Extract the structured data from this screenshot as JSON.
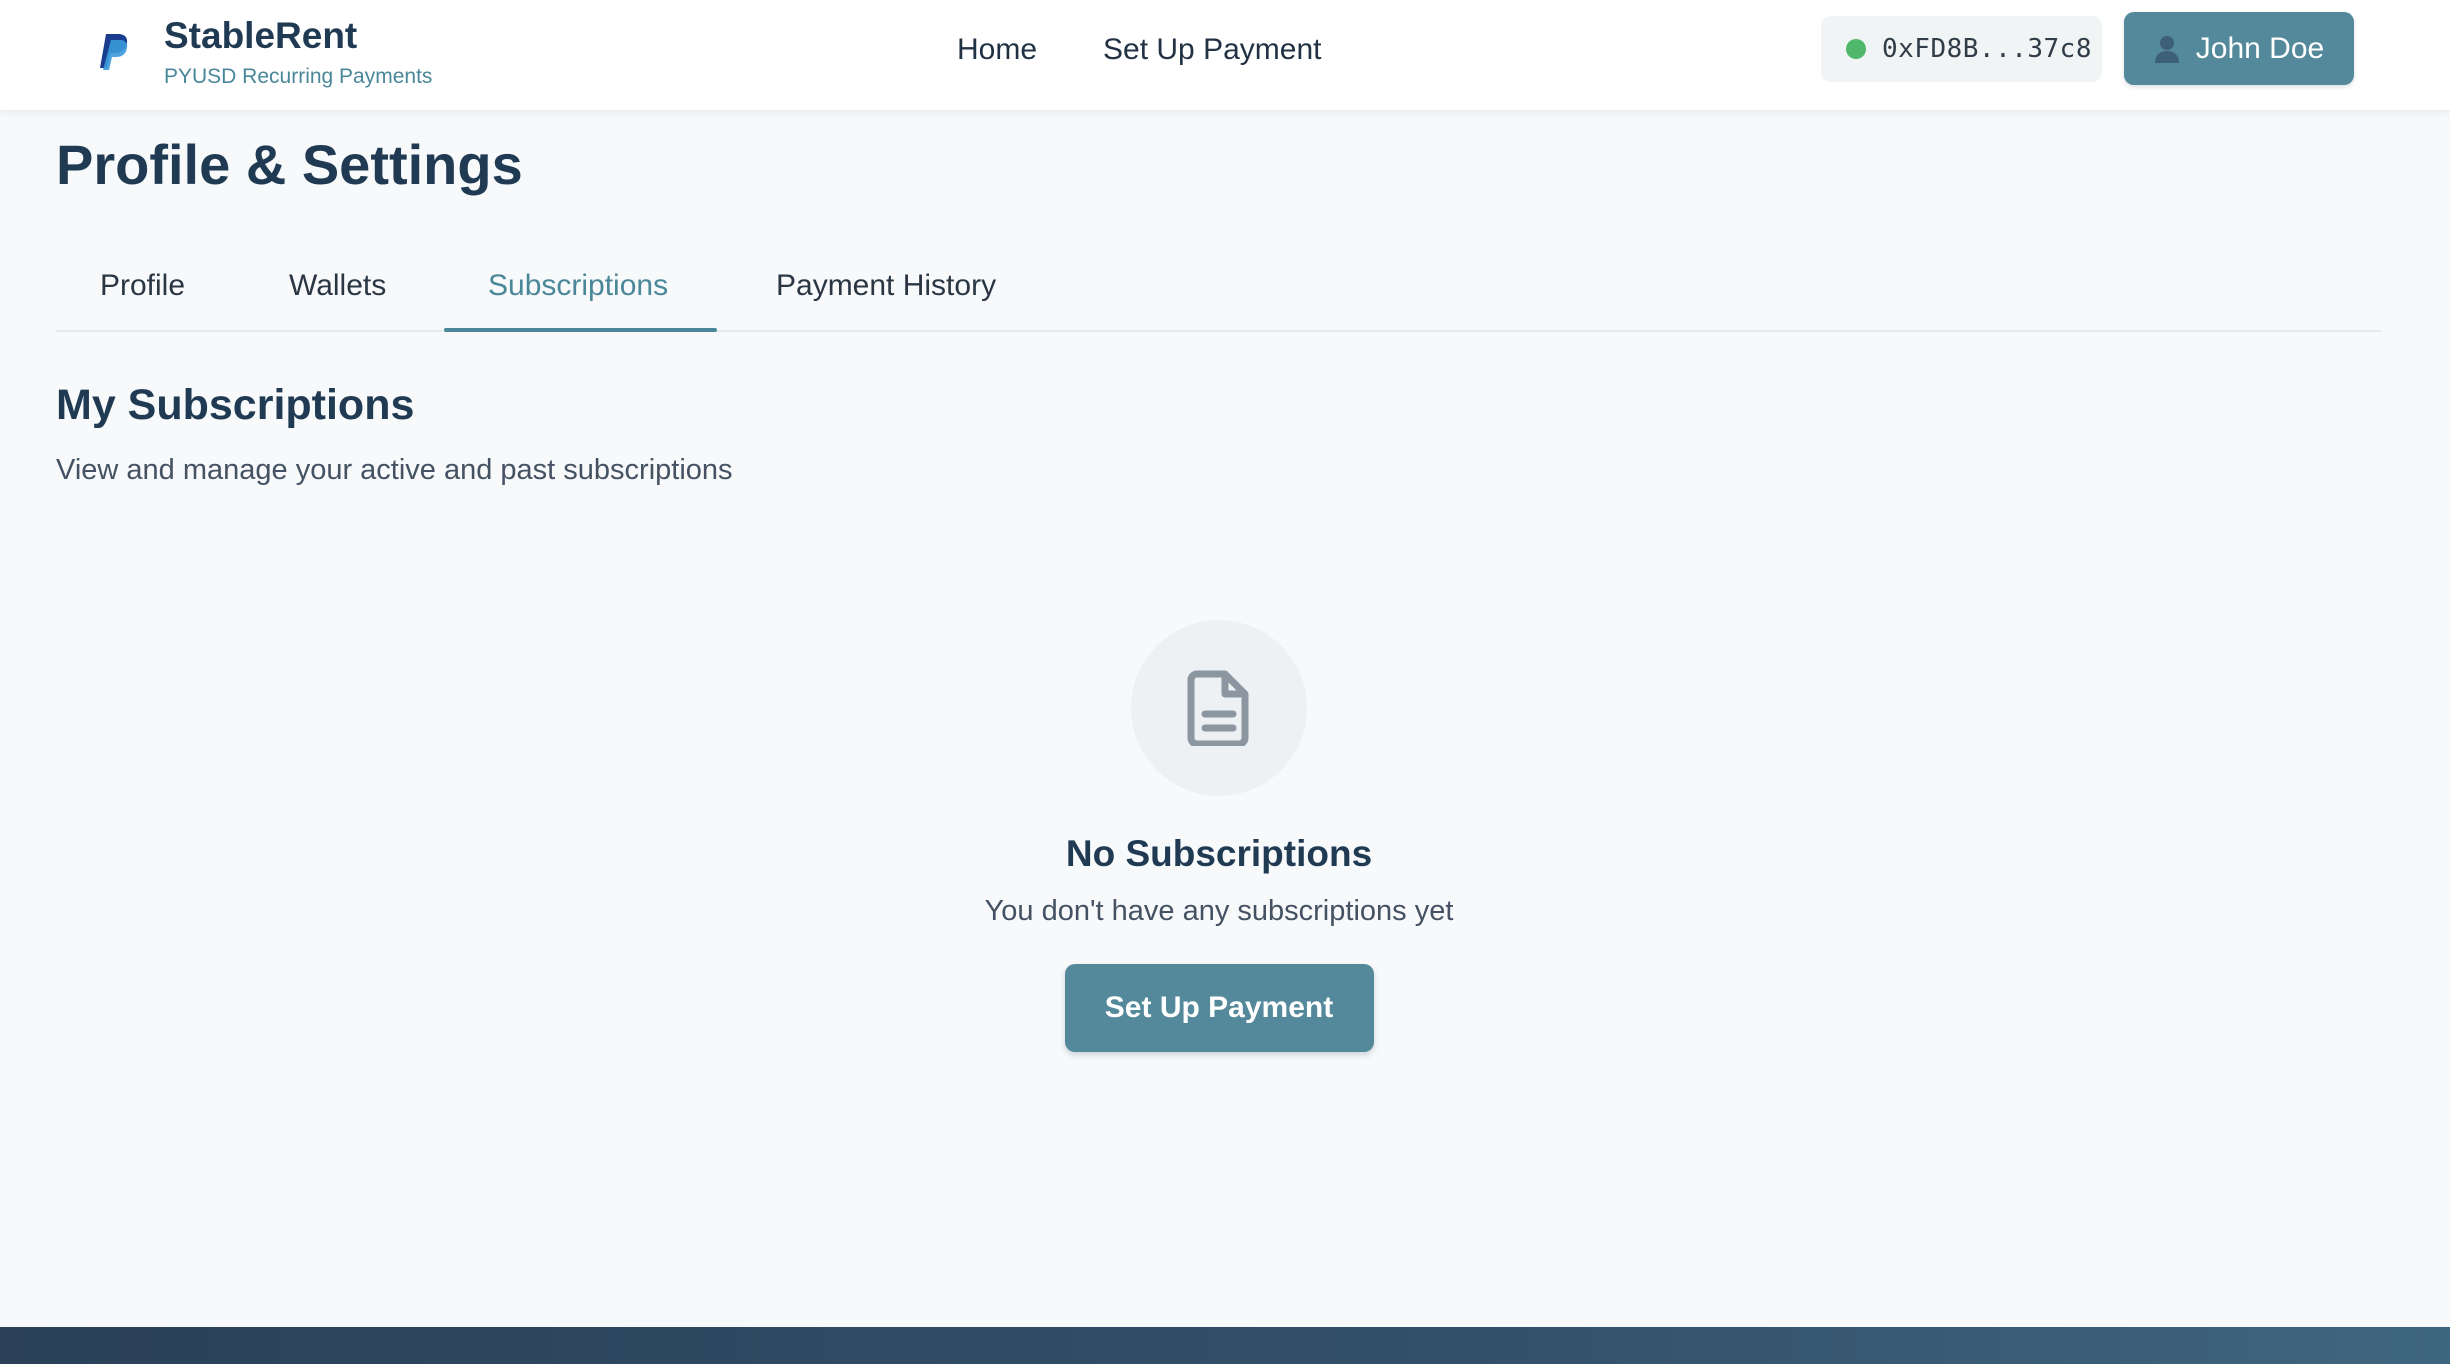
{
  "header": {
    "brand_name": "StableRent",
    "brand_subtitle": "PYUSD Recurring Payments",
    "nav": [
      {
        "label": "Home"
      },
      {
        "label": "Set Up Payment"
      }
    ],
    "wallet": {
      "address": "0xFD8B...37c8",
      "status_color": "#4fb86a"
    },
    "user": {
      "name": "John Doe",
      "icon": "user-icon"
    }
  },
  "page": {
    "title": "Profile & Settings",
    "tabs": [
      {
        "label": "Profile"
      },
      {
        "label": "Wallets"
      },
      {
        "label": "Subscriptions",
        "active": true
      },
      {
        "label": "Payment History"
      }
    ]
  },
  "subscriptions": {
    "title": "My Subscriptions",
    "subtitle": "View and manage your active and past subscriptions",
    "empty": {
      "icon": "document-icon",
      "title": "No Subscriptions",
      "message": "You don't have any subscriptions yet",
      "cta_label": "Set Up Payment"
    }
  },
  "colors": {
    "accent": "#54899b",
    "accent_text": "#4a8799",
    "heading": "#1f3a52",
    "background": "#f7f9fa"
  }
}
